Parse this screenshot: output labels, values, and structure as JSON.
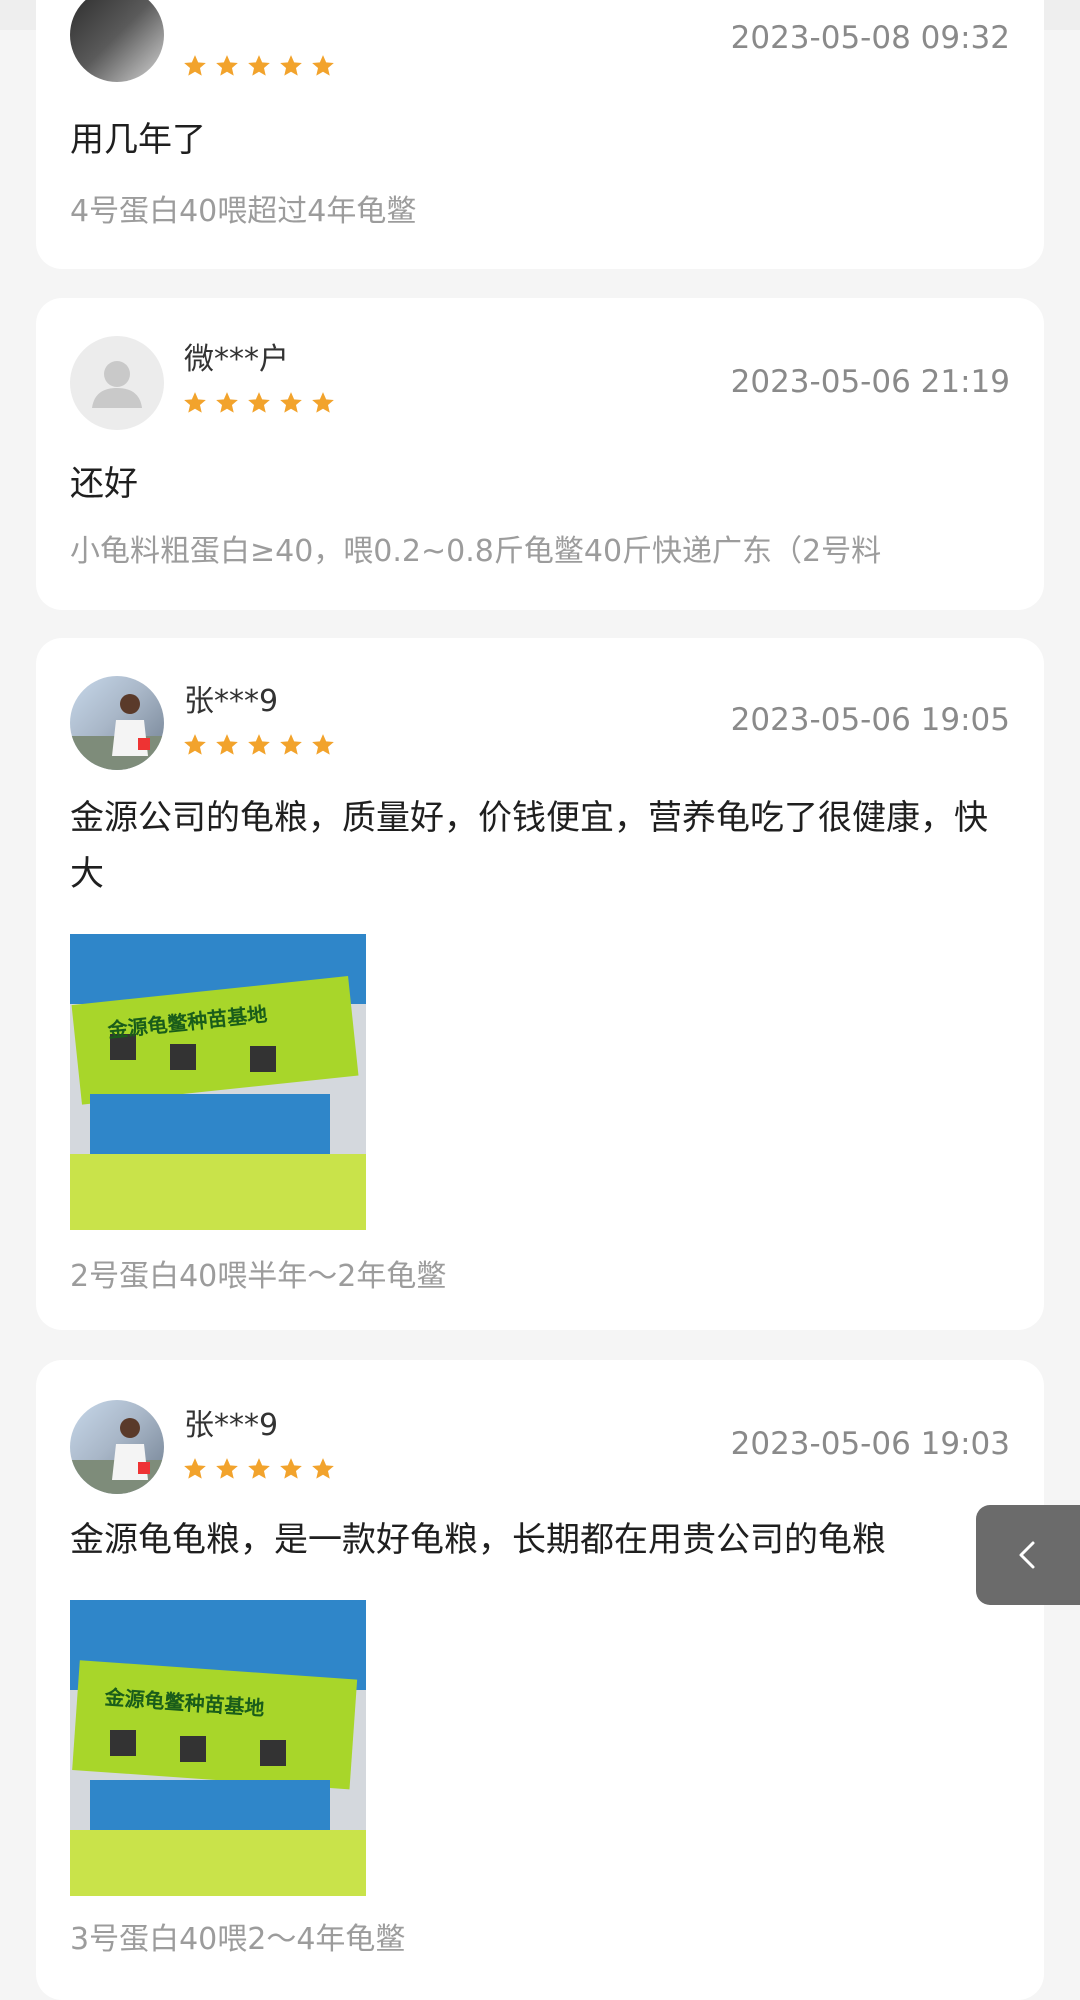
{
  "reviews": [
    {
      "user": "",
      "date": "2023-05-08 09:32",
      "rating": 5,
      "content": "用几年了",
      "spec": "4号蛋白40喂超过4年龟鳖"
    },
    {
      "user": "微***户",
      "date": "2023-05-06 21:19",
      "rating": 5,
      "content": "还好",
      "spec": "小龟料粗蛋白≥40，喂0.2~0.8斤龟鳖40斤快递广东（2号料"
    },
    {
      "user": "张***9",
      "date": "2023-05-06 19:05",
      "rating": 5,
      "content": "金源公司的龟粮，质量好，价钱便宜，营养龟吃了很健康，快大",
      "photo_text": "金源龟鳖种苗基地",
      "spec": "2号蛋白40喂半年～2年龟鳖"
    },
    {
      "user": "张***9",
      "date": "2023-05-06 19:03",
      "rating": 5,
      "content": "金源龟龟粮，是一款好龟粮，长期都在用贵公司的龟粮",
      "photo_text": "金源龟鳖种苗基地",
      "spec": "3号蛋白40喂2～4年龟鳖"
    }
  ],
  "colors": {
    "star": "#f2a32c",
    "date": "#8a8a8a",
    "spec": "#9c9c9c",
    "bag_green": "#a8d62a",
    "bag_blue": "#2f86c9"
  },
  "icons": {
    "star": "star-icon",
    "default_avatar": "user-silhouette-icon",
    "back": "chevron-left-icon"
  }
}
